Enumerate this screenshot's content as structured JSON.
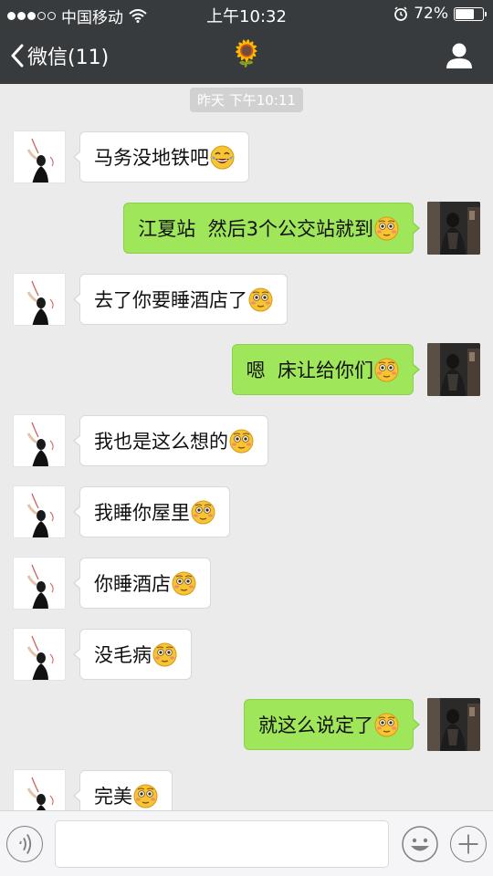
{
  "status_bar": {
    "carrier": "中国移动",
    "time": "上午10:32",
    "battery": "72%",
    "battery_level": 0.72
  },
  "nav": {
    "back_label": "微信(11)",
    "title": "🌻",
    "profile_icon": "person-icon"
  },
  "timestamp": "昨天 下午10:11",
  "messages": [
    {
      "side": "in",
      "text": "马务没地铁吧",
      "emoji": "laughing-tears"
    },
    {
      "side": "out",
      "text": "江夏站  然后3个公交站就到",
      "emoji": "blushing"
    },
    {
      "side": "in",
      "text": "去了你要睡酒店了",
      "emoji": "blushing"
    },
    {
      "side": "out",
      "text": "嗯  床让给你们",
      "emoji": "blushing"
    },
    {
      "side": "in",
      "text": "我也是这么想的",
      "emoji": "blushing"
    },
    {
      "side": "in",
      "text": "我睡你屋里",
      "emoji": "blushing"
    },
    {
      "side": "in",
      "text": "你睡酒店",
      "emoji": "blushing"
    },
    {
      "side": "in",
      "text": "没毛病",
      "emoji": "blushing"
    },
    {
      "side": "out",
      "text": "就这么说定了",
      "emoji": "blushing"
    },
    {
      "side": "in",
      "text": "完美",
      "emoji": "blushing"
    }
  ],
  "input": {
    "value": "",
    "voice_icon": "voice-icon",
    "emoji_icon": "emoji-icon",
    "plus_icon": "plus-icon"
  },
  "colors": {
    "nav_bg": "#373b3e",
    "chat_bg": "#ebebeb",
    "outgoing_bubble": "#9fe65a",
    "incoming_bubble": "#ffffff"
  }
}
